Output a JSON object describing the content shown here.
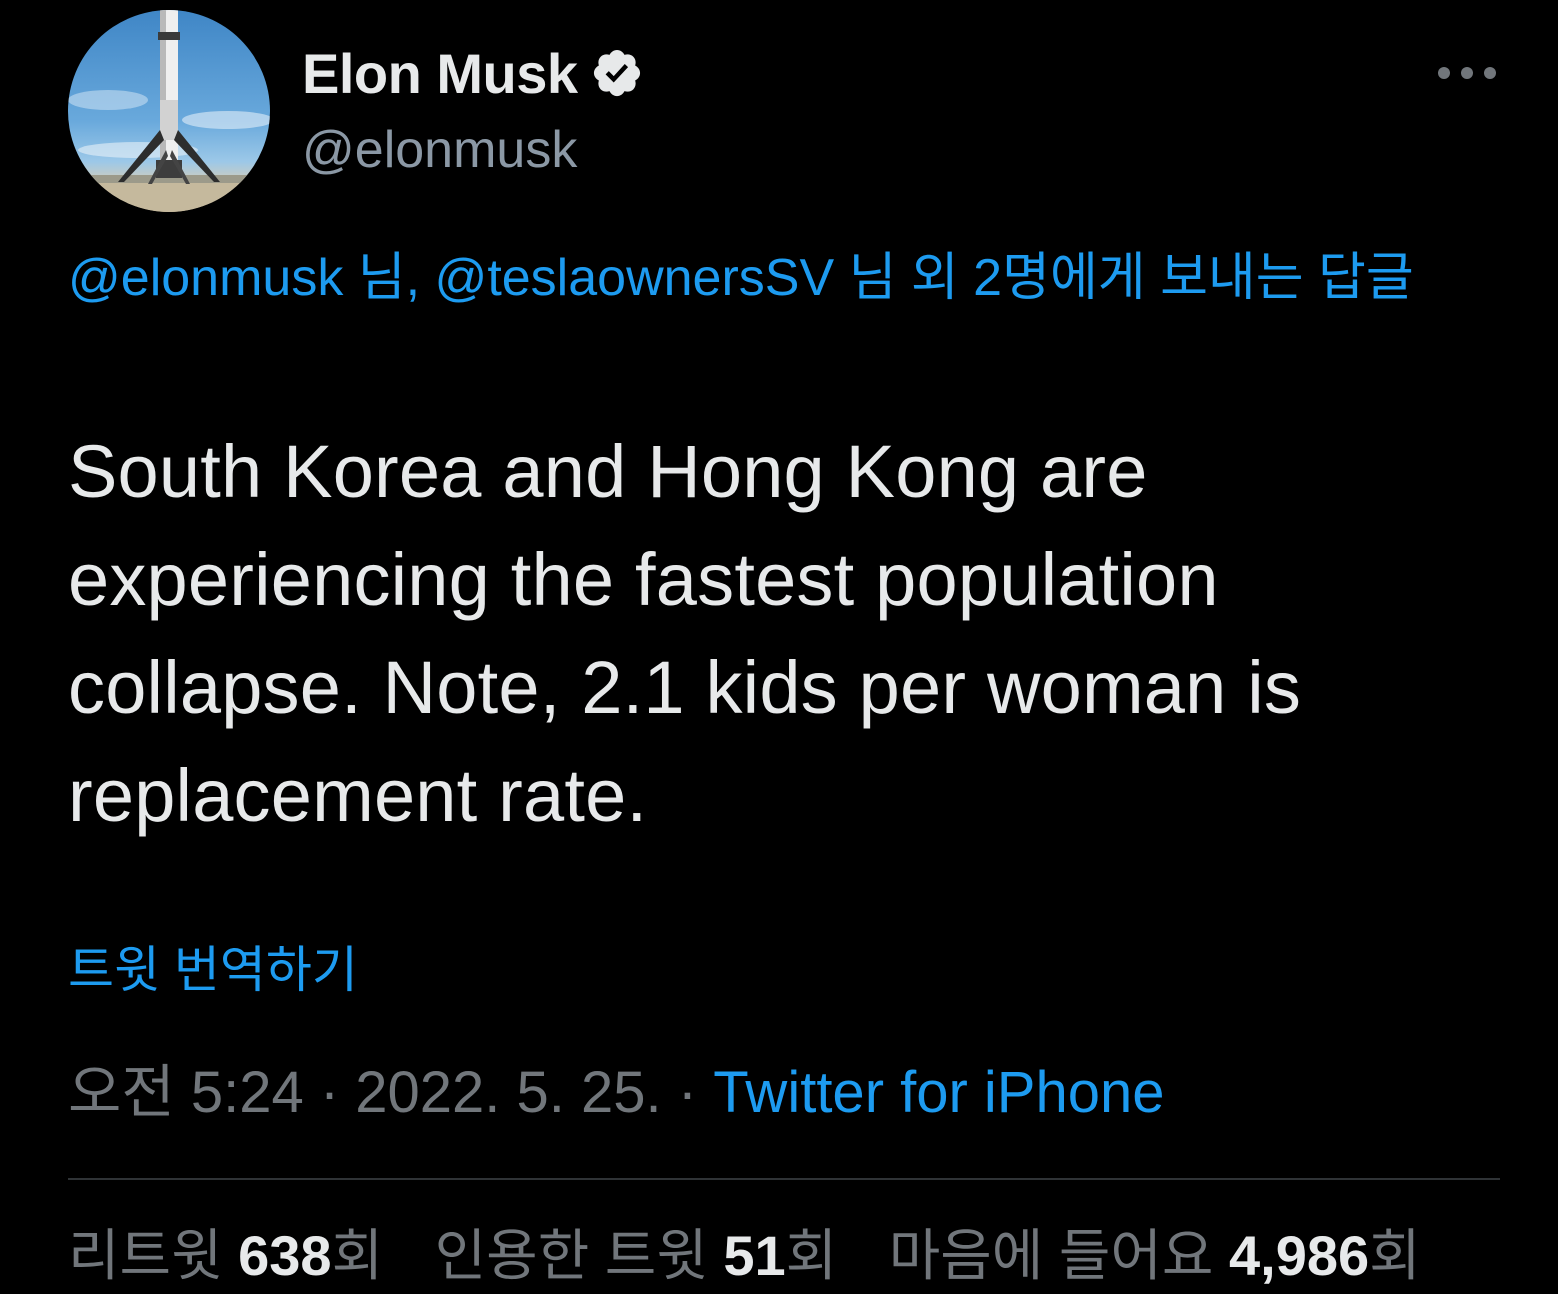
{
  "author": {
    "display_name": "Elon Musk",
    "handle": "@elonmusk",
    "verified": true
  },
  "reply_context": {
    "user1": "@elonmusk",
    "sep1": " 님, ",
    "user2": "@teslaownersSV",
    "suffix": " 님 외 2명에게 보내는 답글"
  },
  "tweet": {
    "text": "South Korea and Hong Kong are experiencing the fastest population collapse. Note, 2.1 kids per woman is replacement rate.",
    "translate_label": "트윗 번역하기"
  },
  "meta": {
    "time": "오전 5:24",
    "sep1": " · ",
    "date": "2022. 5. 25.",
    "sep2": " · ",
    "source": "Twitter for iPhone"
  },
  "stats": {
    "retweets_label": "리트윗 ",
    "retweets_count": "638",
    "retweets_unit": "회",
    "quotes_label": "인용한 트윗 ",
    "quotes_count": "51",
    "quotes_unit": "회",
    "likes_label": "마음에 들어요 ",
    "likes_count": "4,986",
    "likes_unit": "회"
  },
  "icons": {
    "verified": "verified-badge-icon",
    "more": "more-options-icon"
  },
  "colors": {
    "background": "#000000",
    "accent": "#1d9bf0",
    "text_primary": "#e7e9ea",
    "text_secondary": "#71767b"
  }
}
